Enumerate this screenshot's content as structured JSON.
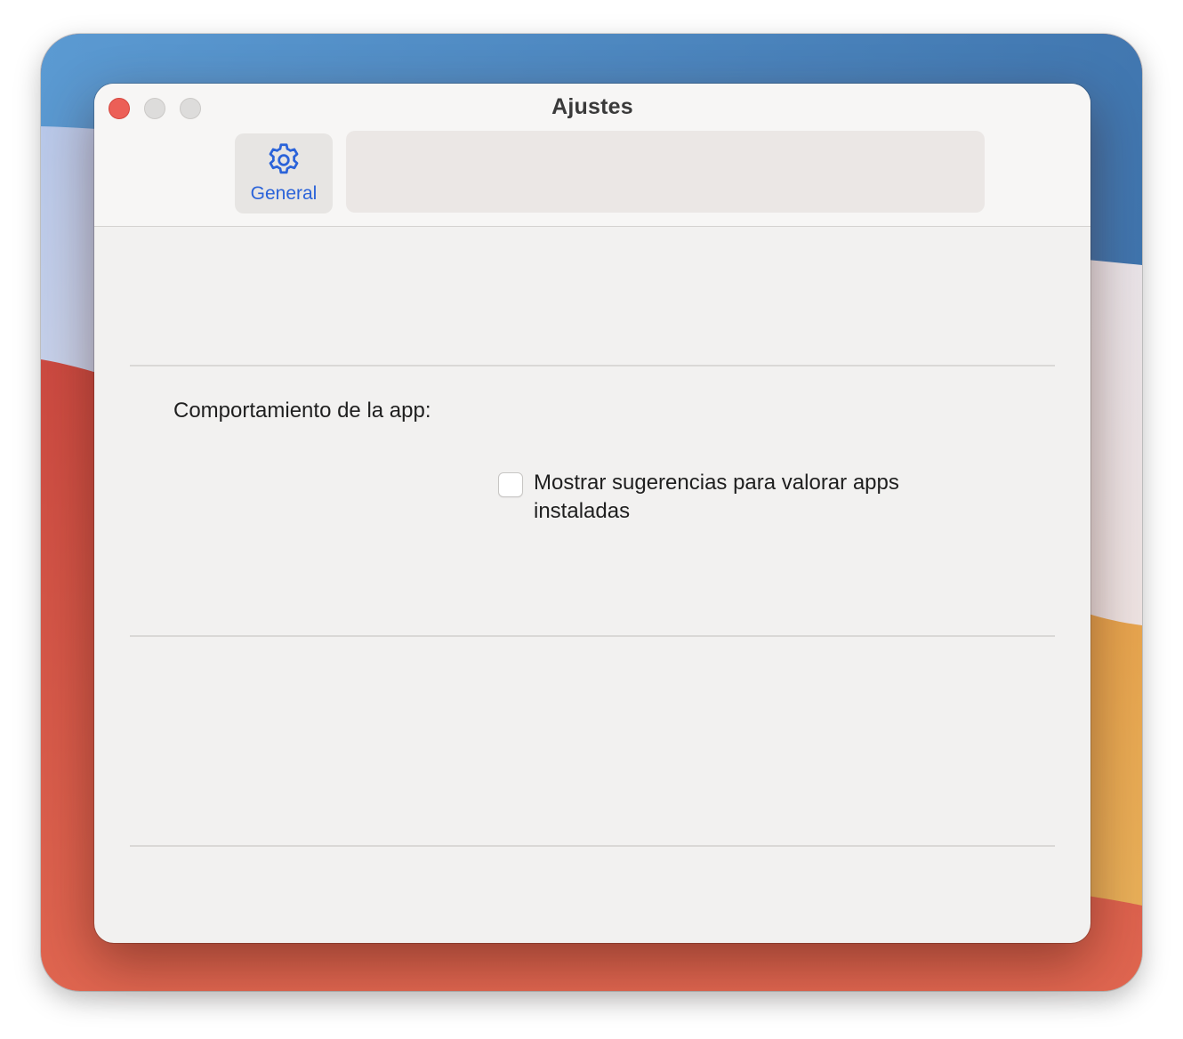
{
  "window": {
    "title": "Ajustes"
  },
  "toolbar": {
    "tabs": [
      {
        "label": "General",
        "icon": "gear-icon",
        "selected": true
      }
    ]
  },
  "content": {
    "section_label": "Comportamiento de la app:",
    "checkbox": {
      "label": "Mostrar sugerencias para valorar apps instaladas",
      "checked": false
    }
  },
  "colors": {
    "accent": "#2b63d9",
    "close": "#ec5f57"
  }
}
